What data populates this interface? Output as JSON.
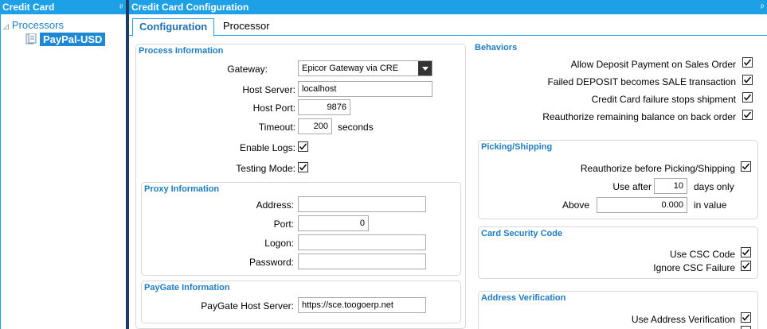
{
  "left_panel": {
    "title": "Credit Card",
    "pin_glyph": "ᵖ",
    "tree": {
      "root_label": "Processors",
      "root_arrow": "◿",
      "child_label": "PayPal-USD"
    }
  },
  "right_panel": {
    "title": "Credit Card Configuration",
    "pin_glyph": "ᵖ",
    "tabs": [
      "Configuration",
      "Processor"
    ]
  },
  "process_info": {
    "title": "Process Information",
    "gateway_label": "Gateway:",
    "gateway_value": "Epicor Gateway via CRE",
    "host_server_label": "Host Server:",
    "host_server_value": "localhost",
    "host_port_label": "Host Port:",
    "host_port_value": "9876",
    "timeout_label": "Timeout:",
    "timeout_value": "200",
    "timeout_unit": "seconds",
    "enable_logs_label": "Enable Logs:",
    "enable_logs_checked": true,
    "testing_mode_label": "Testing Mode:",
    "testing_mode_checked": true
  },
  "proxy_info": {
    "title": "Proxy Information",
    "address_label": "Address:",
    "address_value": "",
    "port_label": "Port:",
    "port_value": "0",
    "logon_label": "Logon:",
    "logon_value": "",
    "password_label": "Password:",
    "password_value": ""
  },
  "paygate_info": {
    "title": "PayGate Information",
    "host_label": "PayGate Host Server:",
    "host_value": "https://sce.toogoerp.net"
  },
  "behaviors": {
    "title": "Behaviors",
    "items": [
      {
        "label": "Allow Deposit Payment on Sales Order",
        "checked": true
      },
      {
        "label": "Failed DEPOSIT becomes SALE transaction",
        "checked": true
      },
      {
        "label": "Credit Card failure stops shipment",
        "checked": true
      },
      {
        "label": "Reauthorize remaining balance on back order",
        "checked": true
      }
    ]
  },
  "picking": {
    "title": "Picking/Shipping",
    "reauth_label": "Reauthorize before Picking/Shipping",
    "reauth_checked": true,
    "use_after_label": "Use after",
    "use_after_value": "10",
    "use_after_unit": "days only",
    "above_label": "Above",
    "above_value": "0.000",
    "above_unit": "in value"
  },
  "csc": {
    "title": "Card Security Code",
    "use_label": "Use CSC Code",
    "use_checked": true,
    "ignore_label": "Ignore CSC Failure",
    "ignore_checked": true
  },
  "avs": {
    "title": "Address Verification",
    "use_label": "Use Address Verification",
    "use_checked": true
  },
  "colors": {
    "header_blue": "#1ea0e6",
    "group_title_blue": "#1f7cc1",
    "selection_blue": "#1e88d4",
    "splitter_navy": "#1d3b63"
  }
}
